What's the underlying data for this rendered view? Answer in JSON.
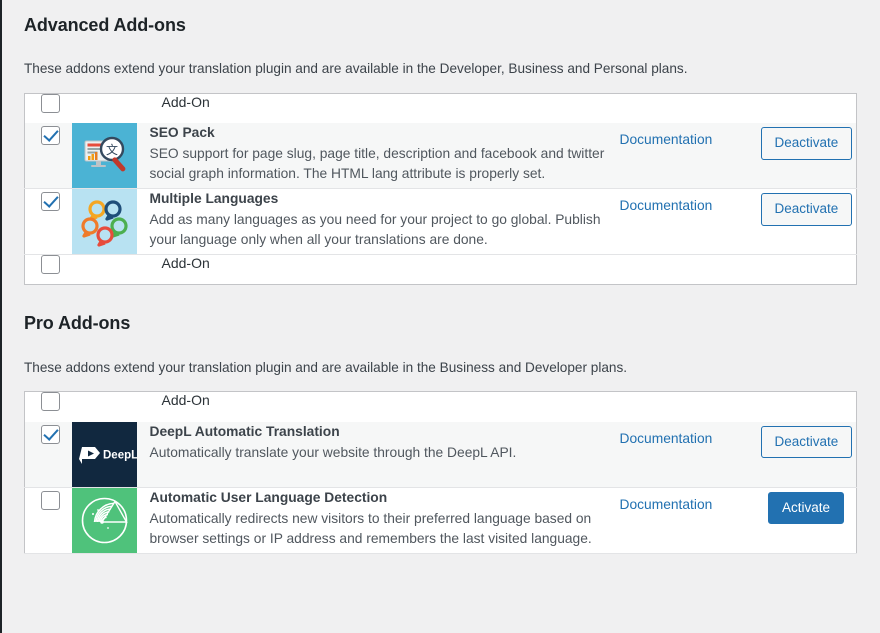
{
  "colors": {
    "accent": "#2271b1",
    "page_bg": "#f0f0f1",
    "row_alt_bg": "#f6f7f7",
    "border": "#c3c4c7",
    "text": "#3c434a"
  },
  "sections": [
    {
      "id": "advanced",
      "title": "Advanced Add-ons",
      "description": "These addons extend your translation plugin and are available in the Developer, Business and Personal plans.",
      "header_label": "Add-On",
      "footer_label": "Add-On",
      "header_checkbox_checked": false,
      "footer_checkbox_checked": false,
      "rows": [
        {
          "checked": true,
          "icon": "seo-pack-icon",
          "name": "SEO Pack",
          "description": "SEO support for page slug, page title, description and facebook and twitter social graph information. The HTML lang attribute is properly set.",
          "doc_label": "Documentation",
          "action_label": "Deactivate",
          "action_style": "secondary"
        },
        {
          "checked": true,
          "icon": "multiple-languages-icon",
          "name": "Multiple Languages",
          "description": "Add as many languages as you need for your project to go global. Publish your language only when all your translations are done.",
          "doc_label": "Documentation",
          "action_label": "Deactivate",
          "action_style": "secondary"
        }
      ]
    },
    {
      "id": "pro",
      "title": "Pro Add-ons",
      "description": "These addons extend your translation plugin and are available in the Business and Developer plans.",
      "header_label": "Add-On",
      "footer_label": "Add-On",
      "header_checkbox_checked": false,
      "footer_checkbox_checked": false,
      "rows": [
        {
          "checked": true,
          "icon": "deepl-icon",
          "name": "DeepL Automatic Translation",
          "description": "Automatically translate your website through the DeepL API.",
          "doc_label": "Documentation",
          "action_label": "Deactivate",
          "action_style": "secondary"
        },
        {
          "checked": false,
          "icon": "language-detection-icon",
          "name": "Automatic User Language Detection",
          "description": "Automatically redirects new visitors to their preferred language based on browser settings or IP address and remembers the last visited language.",
          "doc_label": "Documentation",
          "action_label": "Activate",
          "action_style": "primary"
        }
      ]
    }
  ]
}
